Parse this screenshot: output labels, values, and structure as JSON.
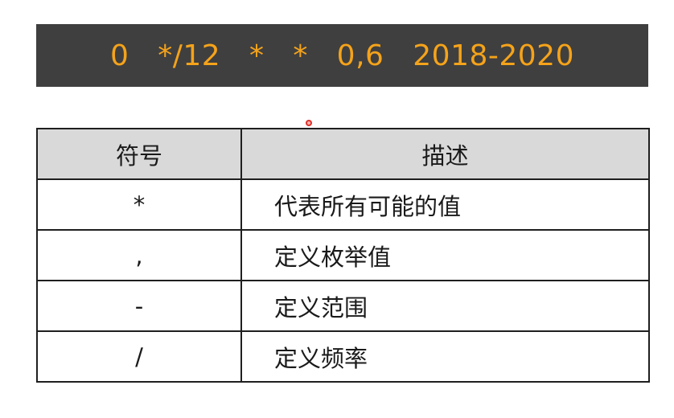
{
  "banner": {
    "expression": "0   */12   *   *   0,6   2018-2020"
  },
  "table": {
    "headers": [
      "符号",
      "描述"
    ],
    "rows": [
      {
        "symbol": "*",
        "description": "代表所有可能的值"
      },
      {
        "symbol": ",",
        "description": "定义枚举值"
      },
      {
        "symbol": "-",
        "description": "定义范围"
      },
      {
        "symbol": "/",
        "description": "定义频率"
      }
    ]
  },
  "colors": {
    "banner_background": "#3f3f3f",
    "banner_text": "#f5a31a",
    "header_background": "#d9d9d9",
    "border": "#1f1f1f"
  }
}
